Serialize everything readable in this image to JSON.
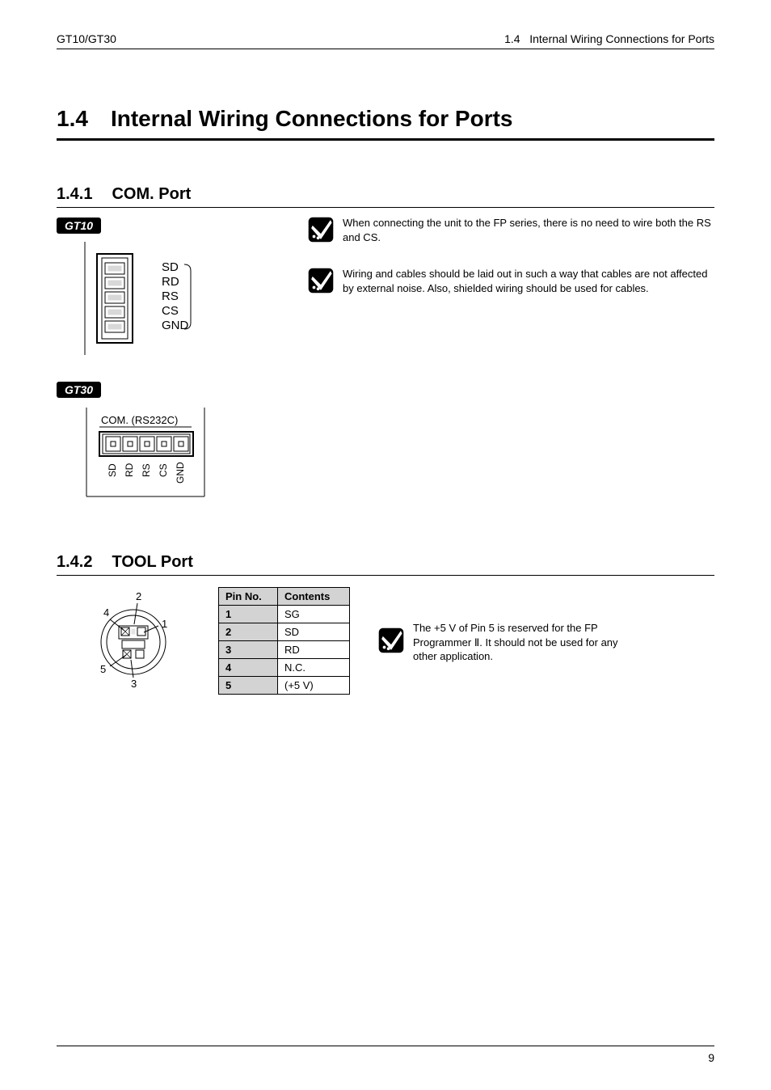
{
  "header": {
    "left": "GT10/GT30",
    "right_num": "1.4",
    "right_title": "Internal Wiring Connections for Ports"
  },
  "section": {
    "num": "1.4",
    "title": "Internal Wiring Connections for Ports"
  },
  "sub1": {
    "num": "1.4.1",
    "title": "COM. Port",
    "badge_gt10": "GT10",
    "badge_gt30": "GT30",
    "gt10_labels": {
      "sd": "SD",
      "rd": "RD",
      "rs": "RS",
      "cs": "CS",
      "gnd": "GND"
    },
    "gt30_title": "COM. (RS232C)",
    "gt30_labels": {
      "sd": "SD",
      "rd": "RD",
      "rs": "RS",
      "cs": "CS",
      "gnd": "GND"
    },
    "note1": "When connecting the unit to the FP series, there is no need to wire both the RS and CS.",
    "note2": "Wiring and cables should be laid out in such a way that cables are not affected by external noise. Also, shielded wiring should be used for cables."
  },
  "sub2": {
    "num": "1.4.2",
    "title": "TOOL Port",
    "pins_header": {
      "c1": "Pin No.",
      "c2": "Contents"
    },
    "pins": [
      {
        "no": "1",
        "c": "SG"
      },
      {
        "no": "2",
        "c": "SD"
      },
      {
        "no": "3",
        "c": "RD"
      },
      {
        "no": "4",
        "c": "N.C."
      },
      {
        "no": "5",
        "c": "(+5 V)"
      }
    ],
    "pin_labels": {
      "p1": "1",
      "p2": "2",
      "p3": "3",
      "p4": "4",
      "p5": "5"
    },
    "note": "The +5 V of Pin 5 is reserved for the FP Programmer Ⅱ. It should not be used for any other application."
  },
  "footer": {
    "pagenum": "9"
  }
}
